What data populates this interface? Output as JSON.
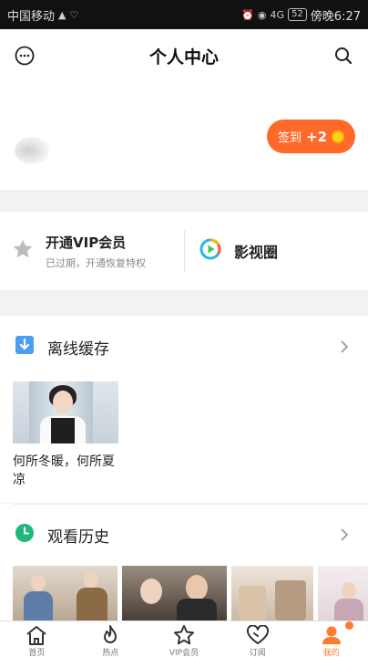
{
  "status_bar": {
    "carrier": "中国移动",
    "signal_text": "4G",
    "battery": "52",
    "time": "傍晚6:27"
  },
  "header": {
    "title": "个人中心",
    "left_icon": "message-icon",
    "right_icon": "search-icon"
  },
  "profile": {
    "checkin_label": "签到",
    "checkin_bonus": "+2"
  },
  "vip_card": {
    "title": "开通VIP会员",
    "subtitle": "已过期，开通恢复特权",
    "icon": "star-icon"
  },
  "circle_card": {
    "title": "影视圈",
    "icon": "play-circle-icon"
  },
  "offline_section": {
    "title": "离线缓存",
    "icon": "download-icon",
    "items": [
      {
        "title": "何所冬暖，何所夏凉"
      }
    ]
  },
  "history_section": {
    "title": "观看历史",
    "icon": "clock-icon"
  },
  "tabbar": {
    "tabs": [
      {
        "label": "首页",
        "icon": "home-icon",
        "active": false
      },
      {
        "label": "热点",
        "icon": "fire-icon",
        "active": false
      },
      {
        "label": "VIP会员",
        "icon": "vip-star-icon",
        "active": false
      },
      {
        "label": "订阅",
        "icon": "heart-icon",
        "active": false
      },
      {
        "label": "我的",
        "icon": "user-icon",
        "active": true
      }
    ]
  },
  "colors": {
    "accent": "#ff6a2b",
    "coin": "#ffd11a",
    "download_icon": "#4a9ff0",
    "clock_icon": "#1fb77a"
  }
}
